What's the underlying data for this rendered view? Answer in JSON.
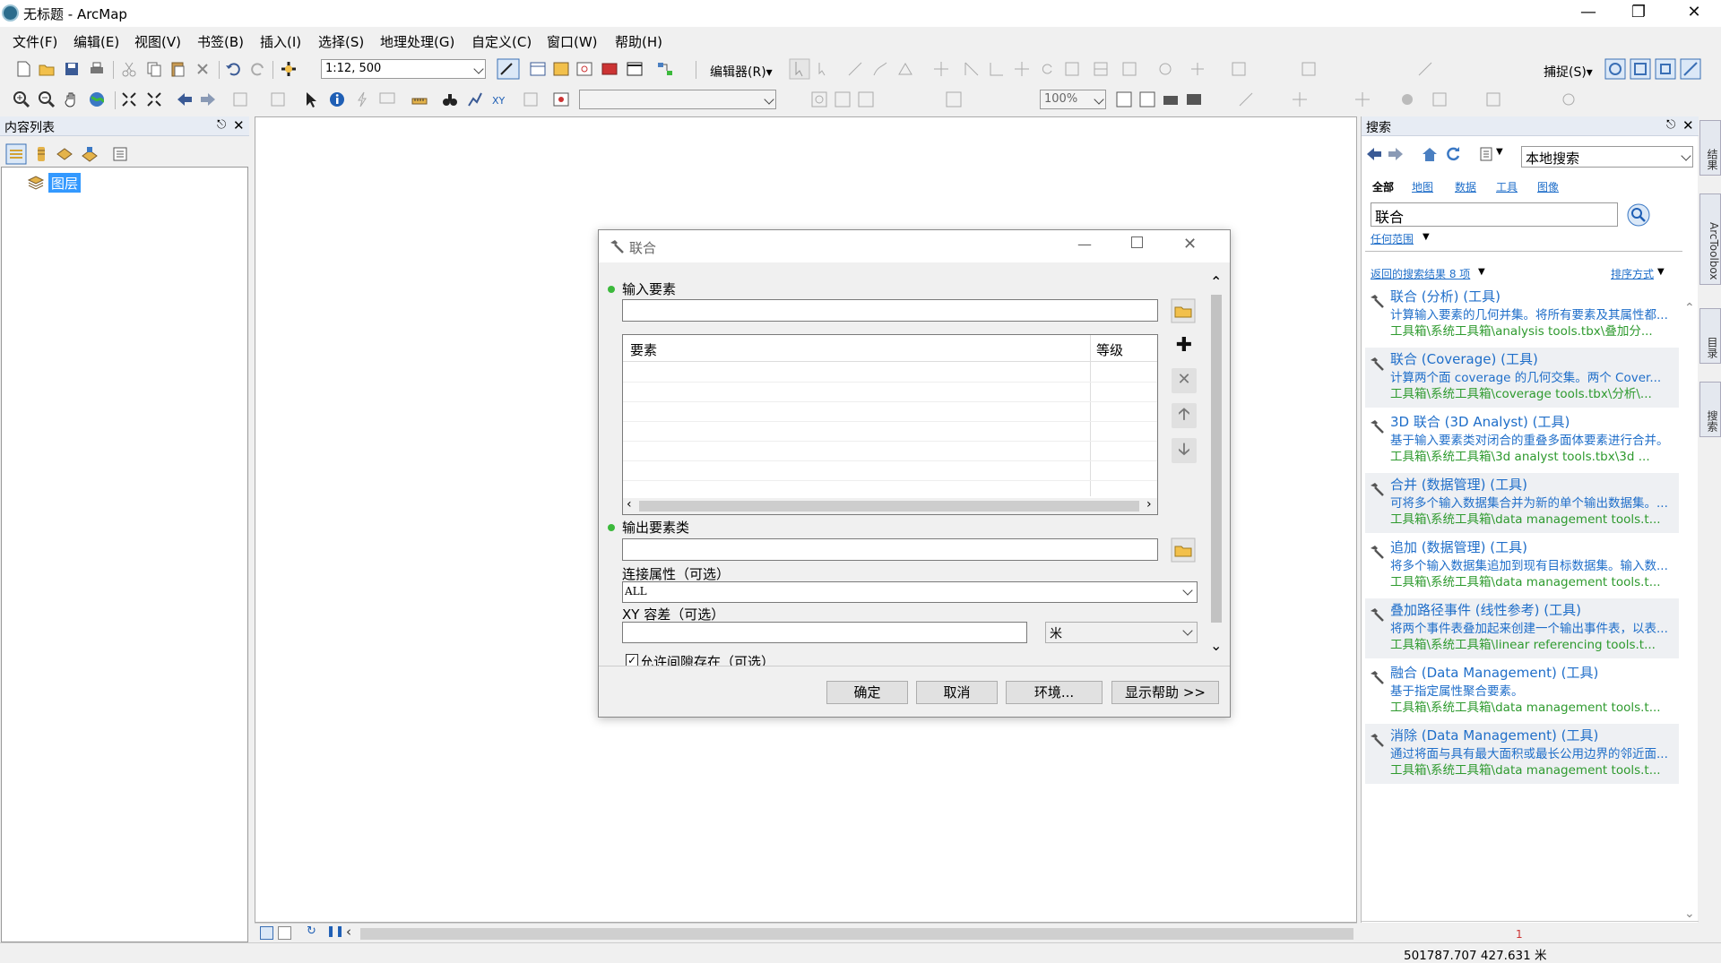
{
  "window": {
    "title": "无标题 - ArcMap"
  },
  "menubar": [
    "文件(F)",
    "编辑(E)",
    "视图(V)",
    "书签(B)",
    "插入(I)",
    "选择(S)",
    "地理处理(G)",
    "自定义(C)",
    "窗口(W)",
    "帮助(H)"
  ],
  "toolbar": {
    "scale_value": "1:12, 500",
    "editor_label": "编辑器(R)▾",
    "snapping_label": "捕捉(S)▾",
    "zoom_value": "100%"
  },
  "toc": {
    "title": "内容列表",
    "layer_root": "图层"
  },
  "search": {
    "title": "搜索",
    "scope_select": "本地搜索",
    "filters": [
      "全部",
      "地图",
      "数据",
      "工具",
      "图像"
    ],
    "query": "联合",
    "range_label": "任何范围",
    "results_count_label": "返回的搜索结果 8 项",
    "sort_label": "排序方式",
    "results": [
      {
        "title": "联合 (分析) (工具)",
        "desc": "计算输入要素的几何并集。将所有要素及其属性都...",
        "path": "工具箱\\系统工具箱\\analysis tools.tbx\\叠加分..."
      },
      {
        "title": "联合 (Coverage) (工具)",
        "desc": "计算两个面 coverage 的几何交集。两个 Cover...",
        "path": "工具箱\\系统工具箱\\coverage tools.tbx\\分析\\..."
      },
      {
        "title": "3D 联合 (3D Analyst) (工具)",
        "desc": "基于输入要素类对闭合的重叠多面体要素进行合并。",
        "path": "工具箱\\系统工具箱\\3d analyst tools.tbx\\3d ..."
      },
      {
        "title": "合并 (数据管理) (工具)",
        "desc": "可将多个输入数据集合并为新的单个输出数据集。...",
        "path": "工具箱\\系统工具箱\\data management tools.t..."
      },
      {
        "title": "追加 (数据管理) (工具)",
        "desc": "将多个输入数据集追加到现有目标数据集。输入数...",
        "path": "工具箱\\系统工具箱\\data management tools.t..."
      },
      {
        "title": "叠加路径事件 (线性参考) (工具)",
        "desc": "将两个事件表叠加起来创建一个输出事件表，以表...",
        "path": "工具箱\\系统工具箱\\linear referencing tools.t..."
      },
      {
        "title": "融合 (Data Management) (工具)",
        "desc": "基于指定属性聚合要素。",
        "path": "工具箱\\系统工具箱\\data management tools.t..."
      },
      {
        "title": "消除 (Data Management) (工具)",
        "desc": "通过将面与具有最大面积或最长公用边界的邻近面...",
        "path": "工具箱\\系统工具箱\\data management tools.t..."
      }
    ],
    "page_number": "1"
  },
  "right_tabs": [
    "结果",
    "ArcToolbox",
    "目录",
    "搜索"
  ],
  "dialog": {
    "title": "联合",
    "input_features_label": "输入要素",
    "table_headers": [
      "要素",
      "等级"
    ],
    "output_label": "输出要素类",
    "join_attr_label": "连接属性（可选）",
    "join_attr_value": "ALL",
    "xy_tol_label": "XY 容差（可选）",
    "xy_unit": "米",
    "gaps_label": "允许间隙存在（可选）",
    "buttons": {
      "ok": "确定",
      "cancel": "取消",
      "env": "环境...",
      "help": "显示帮助 >>"
    }
  },
  "status": {
    "coords": "501787.707  427.631 米"
  }
}
